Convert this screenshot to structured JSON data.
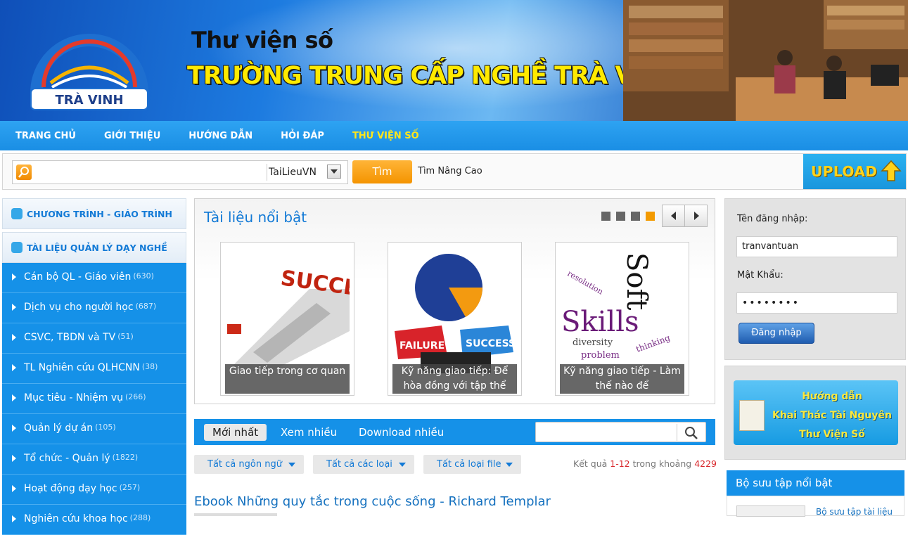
{
  "banner": {
    "logo_text": "TRƯỜNG TRUNG CẤP NGHỀ TRÀ VINH",
    "subtitle": "Thư viện số",
    "title": "TRƯỜNG TRUNG CẤP NGHỀ TRÀ VINH"
  },
  "nav": {
    "items": [
      "TRANG CHỦ",
      "GIỚI THIỆU",
      "HƯỚNG DẪN",
      "HỎI ĐÁP",
      "THƯ VIỆN SỐ"
    ],
    "active": "THƯ VIỆN SỐ"
  },
  "search": {
    "placeholder": "",
    "source_selected": "TaiLieuVN",
    "button": "Tìm",
    "advanced": "Tìm Nâng Cao",
    "upload": "UPLOAD"
  },
  "sidebar": {
    "heading1": "CHƯƠNG TRÌNH - GIÁO TRÌNH",
    "heading2": "TÀI LIỆU QUẢN LÝ DẠY NGHỀ",
    "items": [
      {
        "label": "Cán bộ QL - Giáo viên",
        "count": "(630)"
      },
      {
        "label": "Dịch vụ cho người học",
        "count": "(687)"
      },
      {
        "label": "CSVC, TBDN và TV",
        "count": "(51)"
      },
      {
        "label": "TL Nghiên cứu QLHCNN",
        "count": "(38)"
      },
      {
        "label": "Mục tiêu - Nhiệm vụ",
        "count": "(266)"
      },
      {
        "label": "Quản lý dự án",
        "count": "(105)"
      },
      {
        "label": "Tổ chức - Quản lý",
        "count": "(1822)"
      },
      {
        "label": "Hoạt động dạy học",
        "count": "(257)"
      },
      {
        "label": "Nghiên cứu khoa học",
        "count": "(288)"
      }
    ]
  },
  "featured": {
    "title": "Tài liệu nổi bật",
    "cards": [
      {
        "caption": "Giao tiếp trong cơ quan",
        "image_text": "SUCCESS"
      },
      {
        "caption": "Kỹ năng giao tiếp: Để hòa đồng với tập thể",
        "image_text": "FAILURE SUCCESS"
      },
      {
        "caption": "Kỹ năng giao tiếp - Làm thế nào để",
        "image_text": "Soft Skills"
      }
    ]
  },
  "tabs": {
    "items": [
      "Mới nhất",
      "Xem nhiều",
      "Download nhiều"
    ],
    "active": "Mới nhất"
  },
  "filters": {
    "language": "Tất cả ngôn ngữ",
    "type": "Tất cả các loại",
    "filetype": "Tất cả loại file"
  },
  "result": {
    "prefix": "Kết quả",
    "range": "1-12",
    "middle": "trong khoảng",
    "total": "4229"
  },
  "document": {
    "title": "Ebook Những quy tắc trong cuộc sống - Richard Templar"
  },
  "login": {
    "username_label": "Tên đăng nhập:",
    "username_value": "tranvantuan",
    "password_label": "Mật Khẩu:",
    "password_value": "••••••••",
    "button": "Đăng nhập"
  },
  "guide": {
    "line1": "Hướng dẫn",
    "line2": "Khai Thác Tài Nguyên",
    "line3": "Thư Viện Số"
  },
  "collection": {
    "title": "Bộ sưu tập nổi bật",
    "item": "Bộ sưu tập tài liệu"
  },
  "colors": {
    "primary_blue": "#1591e8",
    "accent_orange": "#f49400",
    "banner_yellow": "#ffea00"
  }
}
